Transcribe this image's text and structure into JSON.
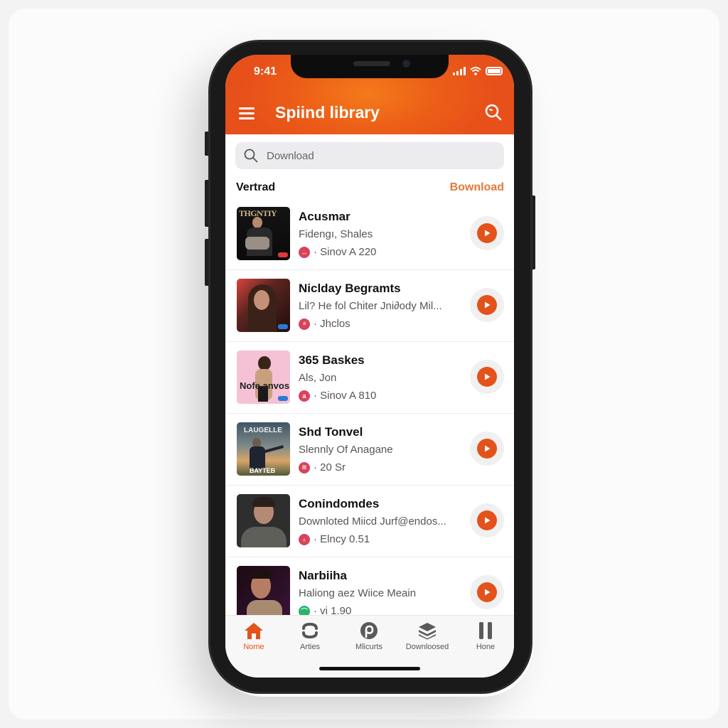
{
  "status_bar": {
    "time": "9:41"
  },
  "header": {
    "title": "Spiind library",
    "menu_icon": "hamburger-menu-icon",
    "search_icon": "search-icon"
  },
  "search": {
    "placeholder": "Download",
    "value": ""
  },
  "section": {
    "title": "Vertrad",
    "link": "Bownload"
  },
  "colors": {
    "accent": "#e3521a",
    "header": "#ec5e17",
    "link": "#e37a3a"
  },
  "tracks": [
    {
      "title": "Acusmar",
      "subtitle": "Fidengı, Shales",
      "meta": "· Sinov A 220",
      "badge_color": "#d9435a",
      "badge_icon": "↔",
      "art_text": "THGNTIY"
    },
    {
      "title": "Nicldaу Begramts",
      "subtitle": "Lil? He fol Chiter Jni∂ody Mil...",
      "meta": "· Jhclos",
      "badge_color": "#d9435a",
      "badge_icon": "ᵈ",
      "art_text": ""
    },
    {
      "title": "365 Baskes",
      "subtitle": "Als, Jon",
      "meta": "· Sinov A 810",
      "badge_color": "#d9435a",
      "badge_icon": "a",
      "art_text": "Nofe anvos"
    },
    {
      "title": "Shd Tonvel",
      "subtitle": "Slennly Of Anagane",
      "meta": "· 20 Sr",
      "badge_color": "#d9435a",
      "badge_icon": "≋",
      "art_text": "LAUGELLE"
    },
    {
      "title": "Conindomdes",
      "subtitle": "Downloted Miicd Jurf@endos...",
      "meta": "· Elncy 0.51",
      "badge_color": "#d9435a",
      "badge_icon": "♁",
      "art_text": ""
    },
    {
      "title": "Narbiiha",
      "subtitle": "Haliong aez Wiice Meain",
      "meta": "· vi 1.90",
      "badge_color": "#2bb36b",
      "badge_icon": "⌒",
      "art_text": ""
    }
  ],
  "tabs": [
    {
      "label": "Nome",
      "icon": "home-icon",
      "active": true
    },
    {
      "label": "Arties",
      "icon": "sync-icon",
      "active": false
    },
    {
      "label": "Mlicurts",
      "icon": "podcast-icon",
      "active": false
    },
    {
      "label": "Downloosed",
      "icon": "layers-icon",
      "active": false
    },
    {
      "label": "Hone",
      "icon": "pause-icon",
      "active": false
    }
  ]
}
